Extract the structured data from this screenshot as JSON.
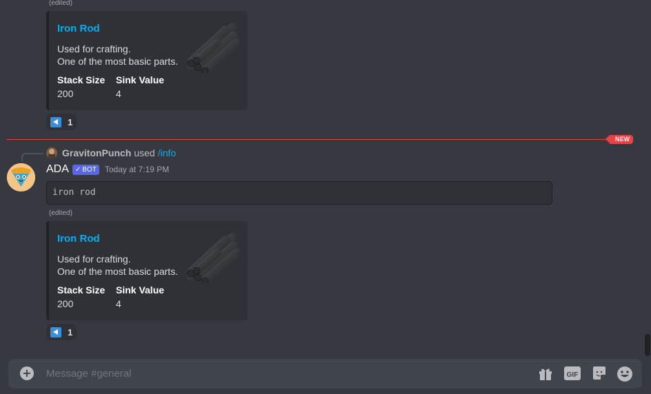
{
  "messages_top": {
    "edited_label": "(edited)",
    "embed": {
      "title": "Iron Rod",
      "description_lines": [
        "Used for crafting.",
        "One of the most basic parts."
      ],
      "fields": [
        {
          "name": "Stack Size",
          "value": "200"
        },
        {
          "name": "Sink Value",
          "value": "4"
        }
      ],
      "thumbnail_icon": "iron-rod-image"
    },
    "reaction": {
      "emoji_icon": "left-arrow-emoji",
      "count": "1"
    }
  },
  "new_divider": {
    "label": "NEW",
    "color": "#ed4245"
  },
  "message": {
    "reply": {
      "user": "GravitonPunch",
      "used": "used",
      "command": "/info"
    },
    "author": "ADA",
    "bot_tag": "BOT",
    "timestamp": "Today at 7:19 PM",
    "code": "iron rod",
    "edited_label": "(edited)",
    "embed": {
      "title": "Iron Rod",
      "description_lines": [
        "Used for crafting.",
        "One of the most basic parts."
      ],
      "fields": [
        {
          "name": "Stack Size",
          "value": "200"
        },
        {
          "name": "Sink Value",
          "value": "4"
        }
      ],
      "thumbnail_icon": "iron-rod-image"
    },
    "reaction": {
      "emoji_icon": "left-arrow-emoji",
      "count": "1"
    }
  },
  "composer": {
    "placeholder": "Message #general",
    "icons": [
      "gift-icon",
      "gif-icon",
      "sticker-icon",
      "emoji-icon"
    ],
    "gif_label": "GIF"
  },
  "colors": {
    "background": "#36393f",
    "embed_bg": "#2f3136",
    "link": "#00aff4",
    "bot_tag": "#5865f2",
    "composer_bg": "#40444b"
  }
}
